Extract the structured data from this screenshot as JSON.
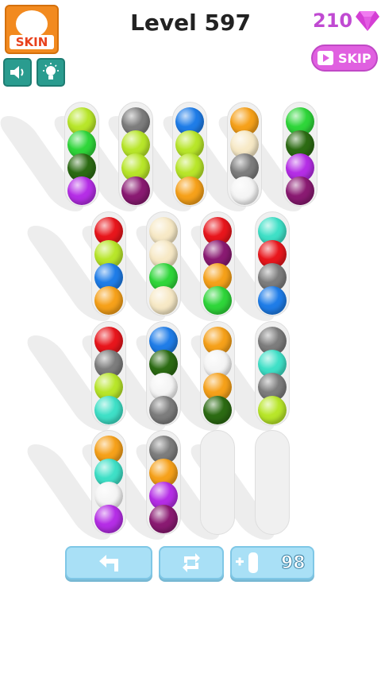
{
  "header": {
    "skin_label": "SKIN",
    "level_title": "Level 597",
    "gems": "210",
    "skip_label": "SKIP"
  },
  "colors": {
    "red": "#e8161c",
    "lime": "#b8e62a",
    "green": "#2fd63a",
    "darkgreen": "#2c6b13",
    "blue": "#1f7de8",
    "orange": "#f6a11a",
    "cream": "#f7e9c6",
    "white": "#f5f5f5",
    "grey": "#7d7d7d",
    "purple": "#b52ee6",
    "plum": "#8a1a72",
    "teal": "#3fe0c7"
  },
  "tubes": [
    [
      "lime",
      "green",
      "darkgreen",
      "purple"
    ],
    [
      "grey",
      "lime",
      "lime",
      "plum"
    ],
    [
      "blue",
      "lime",
      "lime",
      "orange"
    ],
    [
      "orange",
      "cream",
      "grey",
      "white"
    ],
    [
      "green",
      "darkgreen",
      "purple",
      "plum"
    ],
    [
      "red",
      "lime",
      "blue",
      "orange"
    ],
    [
      "cream",
      "cream",
      "green",
      "cream"
    ],
    [
      "red",
      "plum",
      "orange",
      "green"
    ],
    [
      "teal",
      "red",
      "grey",
      "blue"
    ],
    [
      "red",
      "grey",
      "lime",
      "teal"
    ],
    [
      "blue",
      "darkgreen",
      "white",
      "grey"
    ],
    [
      "orange",
      "white",
      "orange",
      "darkgreen"
    ],
    [
      "grey",
      "teal",
      "grey",
      "lime"
    ],
    [
      "orange",
      "teal",
      "white",
      "purple"
    ],
    [
      "grey",
      "orange",
      "purple",
      "plum"
    ],
    [],
    []
  ],
  "controls": {
    "add_tube_count": "98"
  }
}
